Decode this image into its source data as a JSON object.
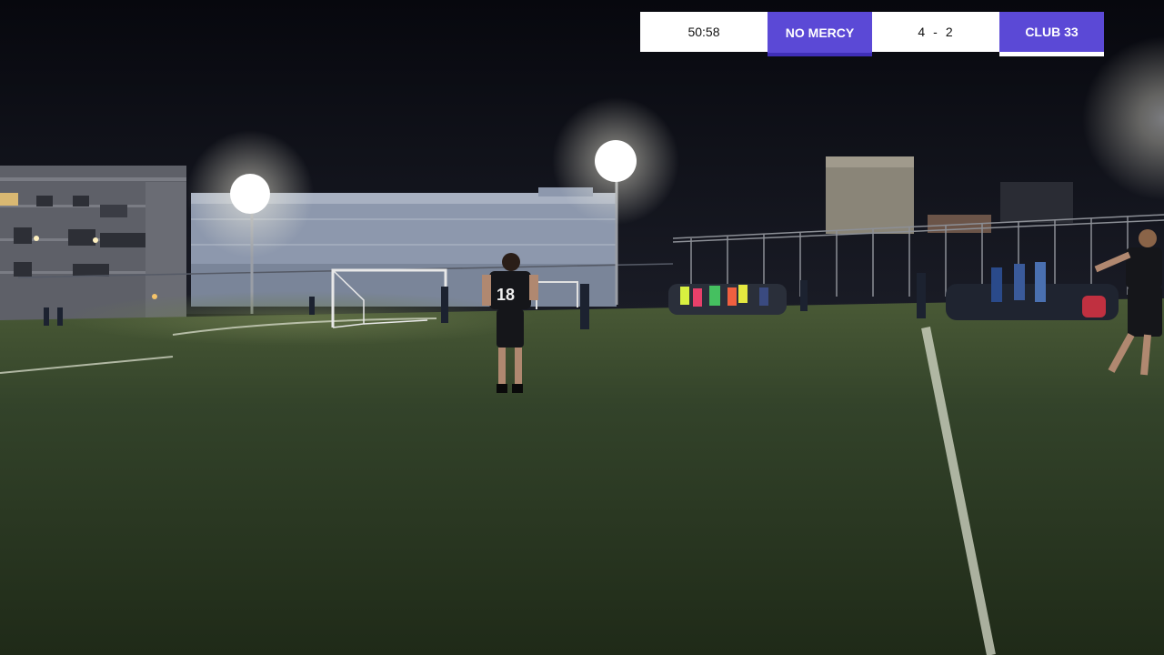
{
  "scoreboard": {
    "clock": "50:58",
    "home_team": "NO MERCY",
    "home_score": "4",
    "separator": "-",
    "away_score": "2",
    "away_team": "CLUB 33"
  },
  "player": {
    "jersey_number": "18"
  },
  "colors": {
    "team_accent": "#5b49d6",
    "scoreboard_bg": "#ffffff",
    "pitch": "#2f3f22",
    "sky": "#0b0d14"
  }
}
